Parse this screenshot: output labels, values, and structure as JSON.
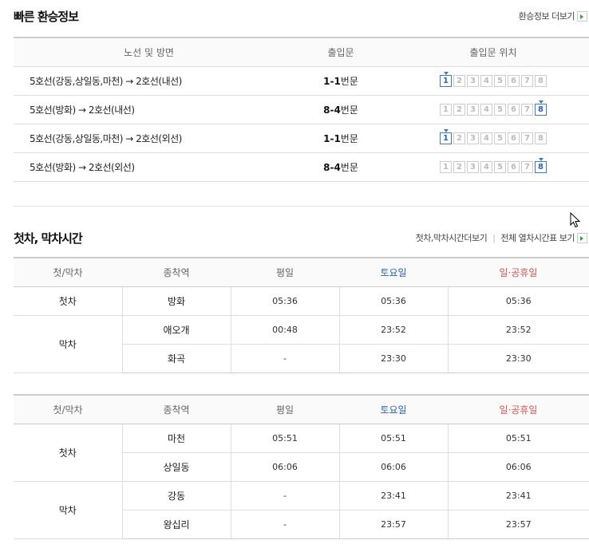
{
  "transfer": {
    "title": "빠른 환승정보",
    "more_label": "환승정보 더보기",
    "headers": [
      "노선 및 방면",
      "출입문",
      "출입문 위치"
    ],
    "rows": [
      {
        "route": "5호선(강동,상일동,마천) → 2호선(내선)",
        "gate_num": "1-1",
        "gate_suffix": "번문",
        "active_car": 1
      },
      {
        "route": "5호선(방화) → 2호선(내선)",
        "gate_num": "8-4",
        "gate_suffix": "번문",
        "active_car": 8
      },
      {
        "route": "5호선(강동,상일동,마천) → 2호선(외선)",
        "gate_num": "1-1",
        "gate_suffix": "번문",
        "active_car": 1
      },
      {
        "route": "5호선(방화) → 2호선(외선)",
        "gate_num": "8-4",
        "gate_suffix": "번문",
        "active_car": 8
      }
    ],
    "cars": [
      "1",
      "2",
      "3",
      "4",
      "5",
      "6",
      "7",
      "8"
    ]
  },
  "timetable": {
    "title": "첫차, 막차시간",
    "link1": "첫차,막차시간더보기",
    "link2": "전체 열차시간표 보기",
    "headers": [
      "첫/막차",
      "종착역",
      "평일",
      "토요일",
      "일·공휴일"
    ],
    "table1": {
      "first_label": "첫차",
      "last_label": "막차",
      "rows": [
        {
          "station": "방화",
          "weekday": "05:36",
          "saturday": "05:36",
          "holiday": "05:36"
        },
        {
          "station": "애오개",
          "weekday": "00:48",
          "saturday": "23:52",
          "holiday": "23:52"
        },
        {
          "station": "화곡",
          "weekday": "-",
          "saturday": "23:30",
          "holiday": "23:30"
        }
      ]
    },
    "table2": {
      "first_label": "첫차",
      "last_label": "막차",
      "rows": [
        {
          "station": "마천",
          "weekday": "05:51",
          "saturday": "05:51",
          "holiday": "05:51"
        },
        {
          "station": "상일동",
          "weekday": "06:06",
          "saturday": "06:06",
          "holiday": "06:06"
        },
        {
          "station": "강동",
          "weekday": "-",
          "saturday": "23:41",
          "holiday": "23:41"
        },
        {
          "station": "왕십리",
          "weekday": "-",
          "saturday": "23:57",
          "holiday": "23:57"
        }
      ]
    }
  },
  "colors": {
    "saturday": "#2a64ad",
    "holiday": "#d9534f",
    "active_car": "#3a79c4",
    "more_arrow": "#2fa12f"
  }
}
